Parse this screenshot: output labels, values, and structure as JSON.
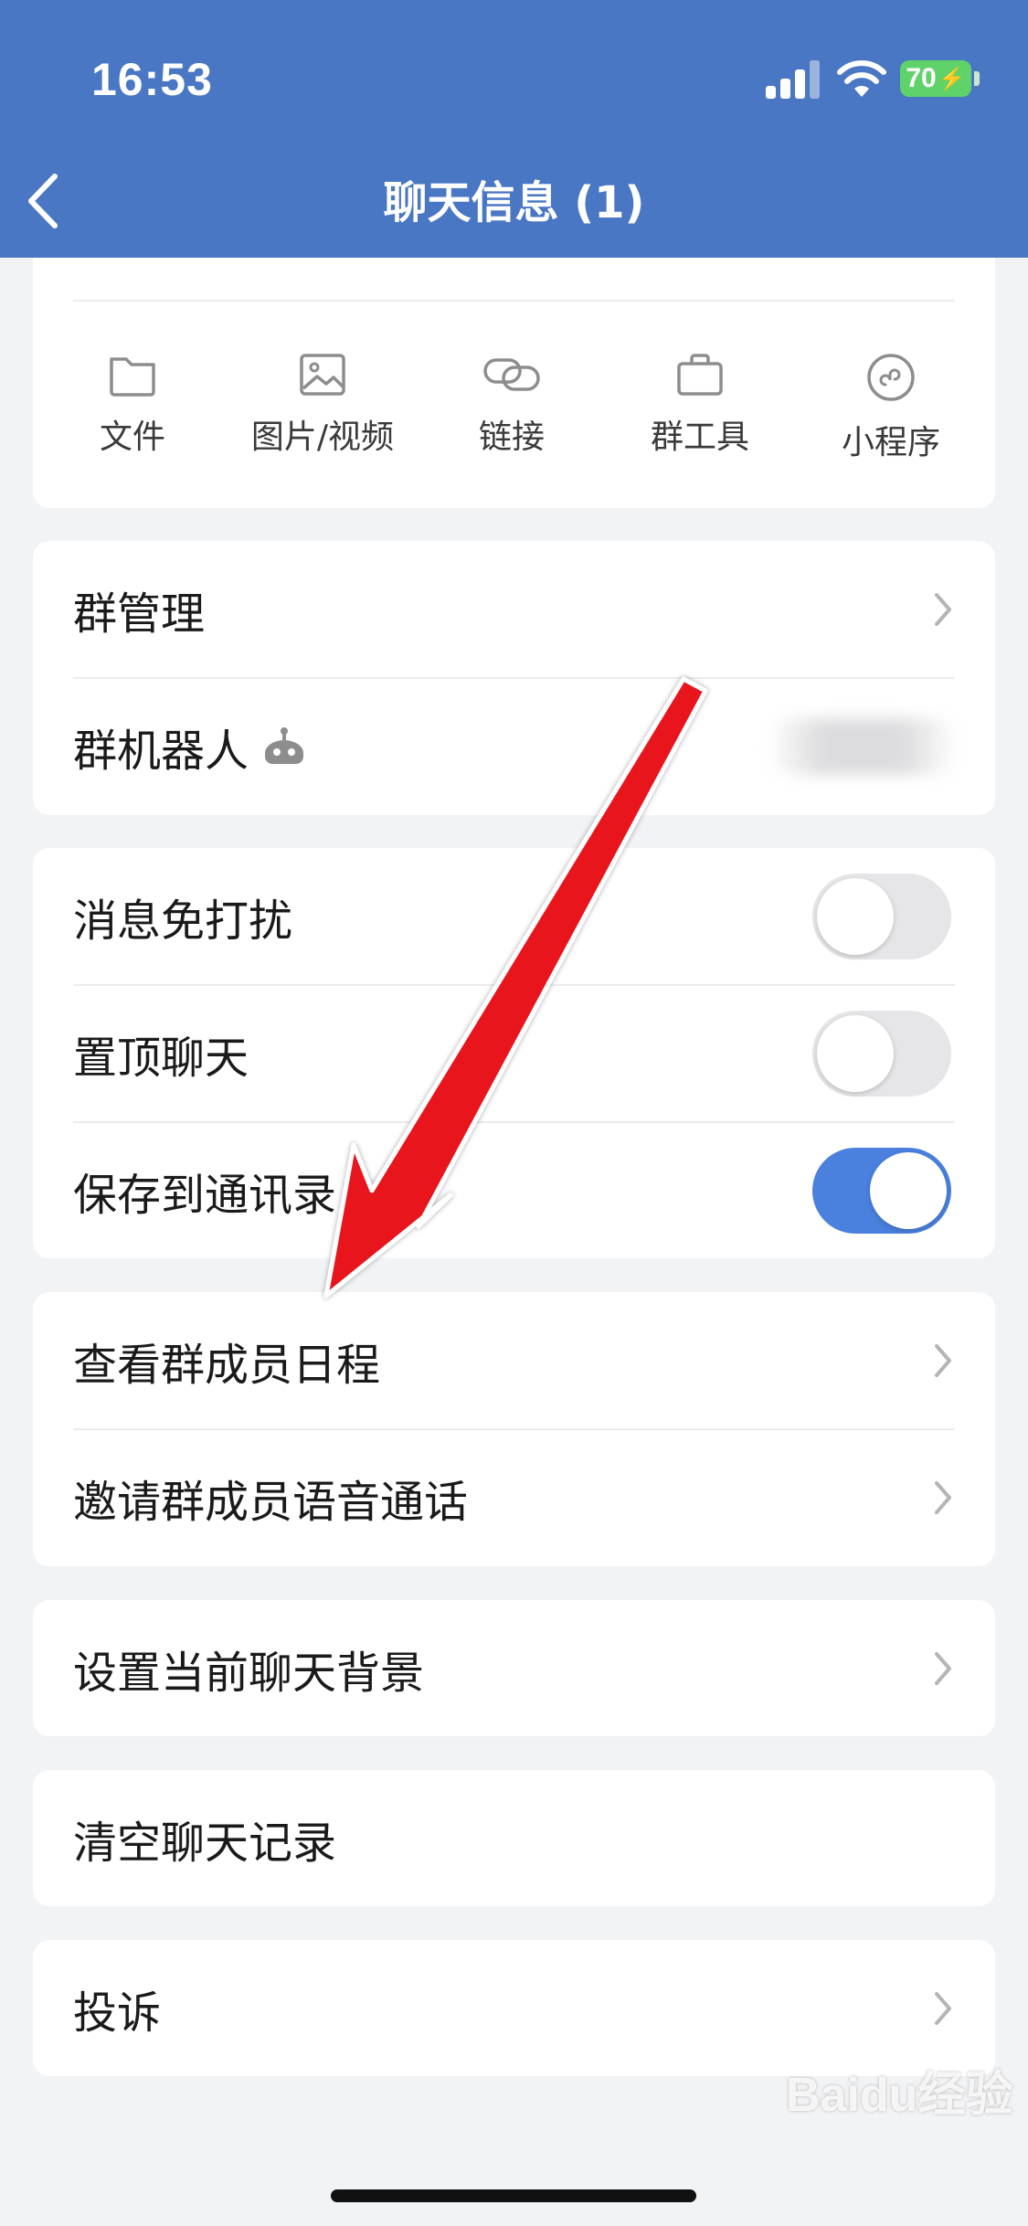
{
  "status_bar": {
    "time": "16:53",
    "battery": "70"
  },
  "header": {
    "title": "聊天信息 (1)"
  },
  "tools": [
    {
      "label": "文件",
      "icon": "folder-icon"
    },
    {
      "label": "图片/视频",
      "icon": "image-icon"
    },
    {
      "label": "链接",
      "icon": "link-icon"
    },
    {
      "label": "群工具",
      "icon": "briefcase-icon"
    },
    {
      "label": "小程序",
      "icon": "mini-program-icon"
    }
  ],
  "group_section": {
    "manage": "群管理",
    "robot": "群机器人"
  },
  "switches": [
    {
      "label": "消息免打扰",
      "on": false
    },
    {
      "label": "置顶聊天",
      "on": false
    },
    {
      "label": "保存到通讯录",
      "on": true
    }
  ],
  "member_section": {
    "schedule": "查看群成员日程",
    "voice_call": "邀请群成员语音通话"
  },
  "background": {
    "label": "设置当前聊天背景"
  },
  "clear": {
    "label": "清空聊天记录"
  },
  "complain": {
    "label": "投诉"
  },
  "watermark": "Baidu经验",
  "colors": {
    "header": "#4a77c4",
    "toggle_on": "#4a80de",
    "arrow": "#e8141b"
  }
}
